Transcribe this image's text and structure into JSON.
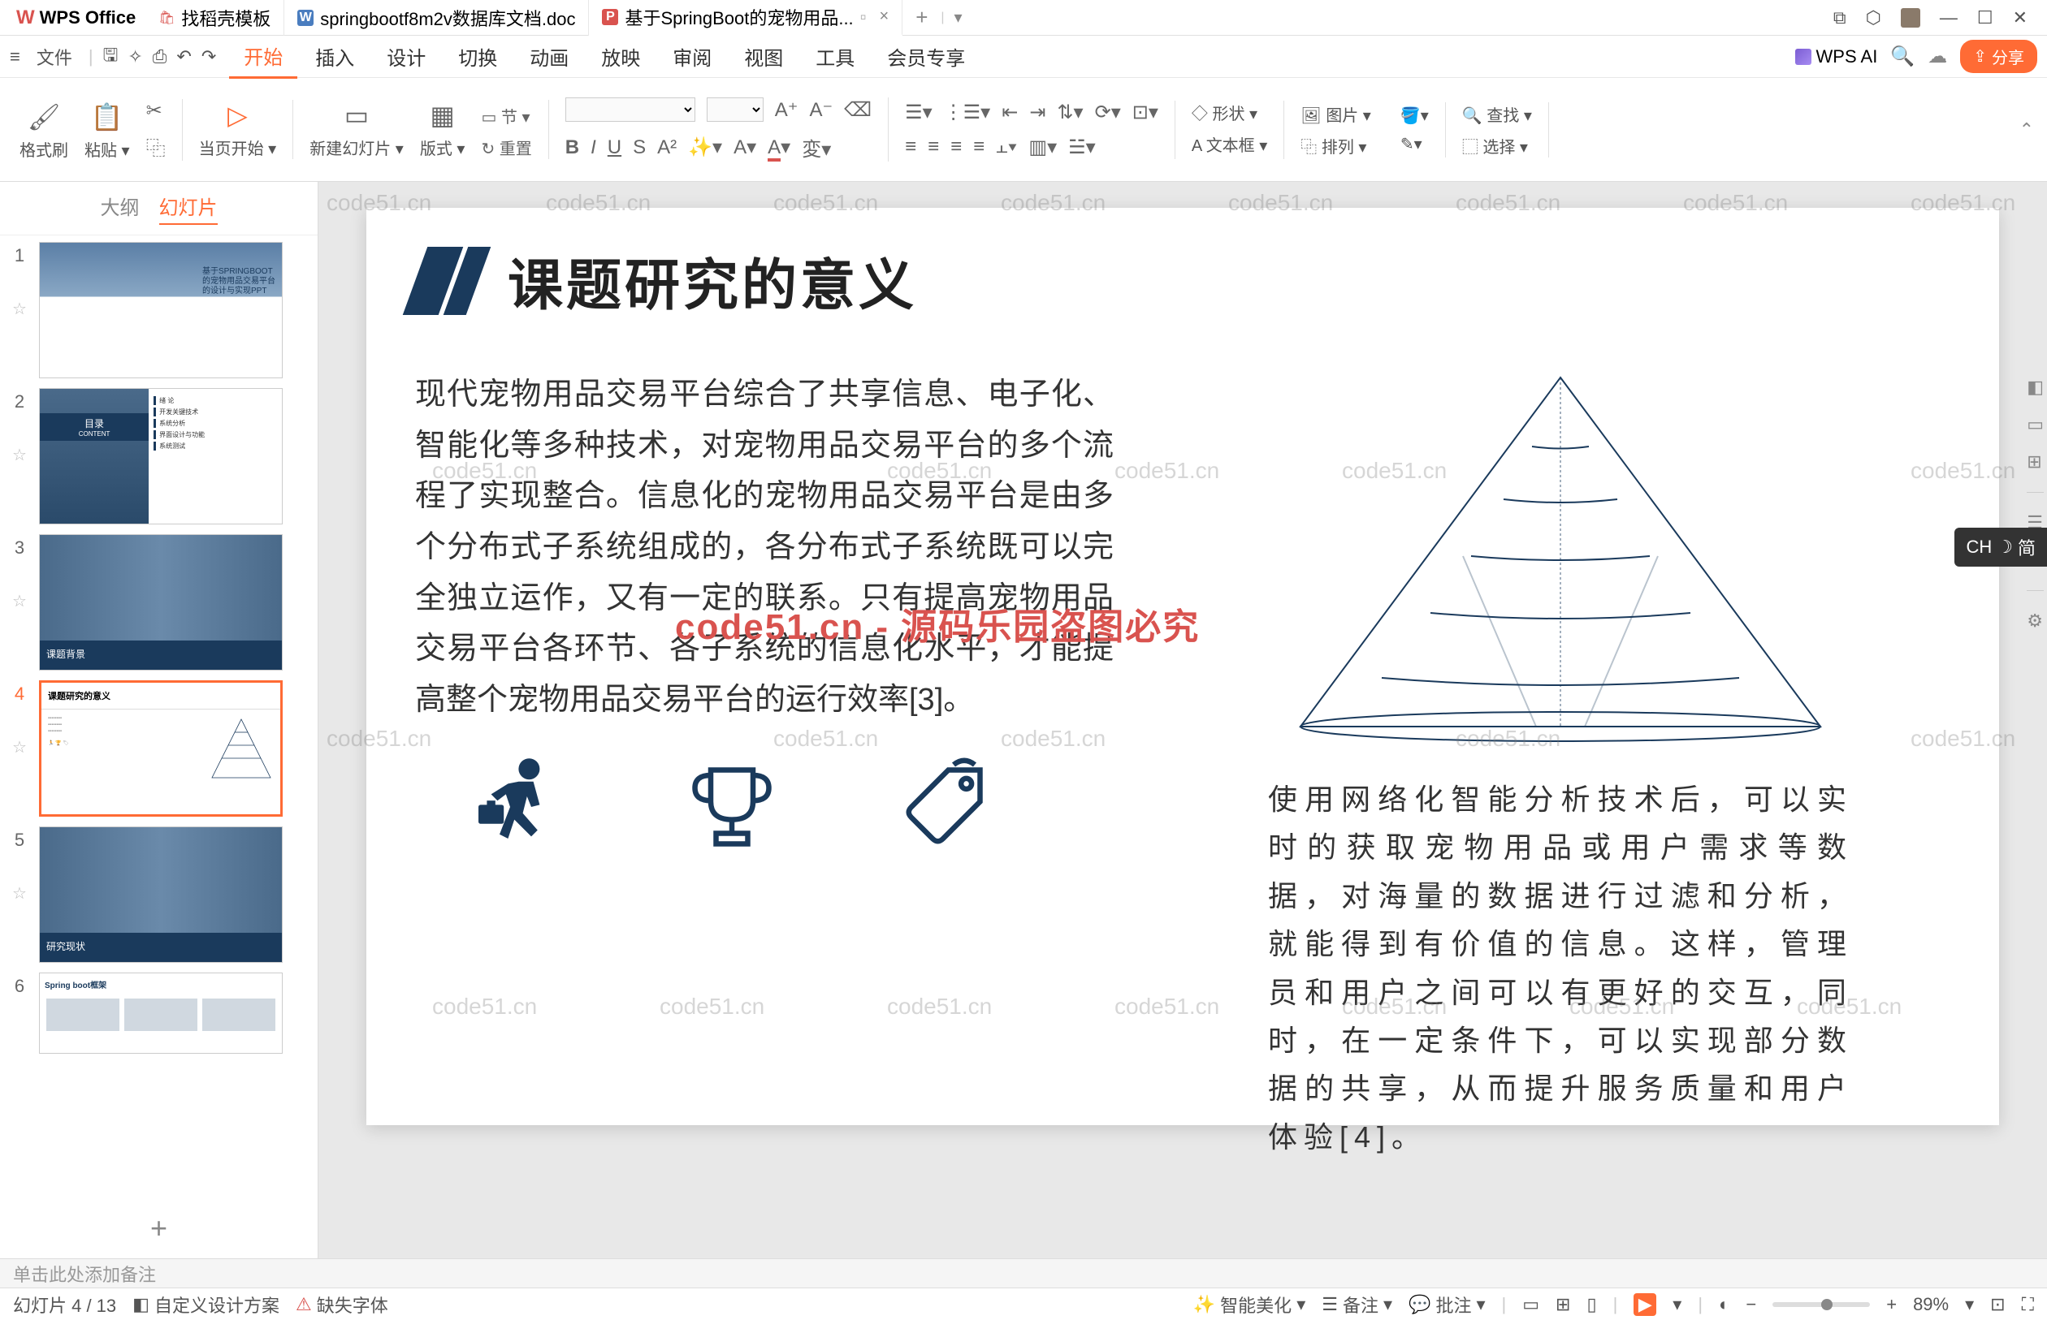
{
  "titlebar": {
    "app_name": "WPS Office",
    "tabs": [
      {
        "icon": "🛍",
        "label": "找稻壳模板",
        "color": "#d9534f"
      },
      {
        "icon": "W",
        "label": "springbootf8m2v数据库文档.doc",
        "color": "#4a7dbf"
      },
      {
        "icon": "P",
        "label": "基于SpringBoot的宠物用品...",
        "color": "#d9534f",
        "active": true
      }
    ]
  },
  "menubar": {
    "file": "文件",
    "items": [
      "开始",
      "插入",
      "设计",
      "切换",
      "动画",
      "放映",
      "审阅",
      "视图",
      "工具",
      "会员专享"
    ],
    "active_index": 0,
    "wps_ai": "WPS AI",
    "share": "分享"
  },
  "ribbon": {
    "format_painter": "格式刷",
    "paste": "粘贴",
    "current_page": "当页开始",
    "new_slide": "新建幻灯片",
    "layout": "版式",
    "section": "节",
    "reset": "重置",
    "shape": "形状",
    "picture": "图片",
    "textbox": "文本框",
    "arrange": "排列",
    "find": "查找",
    "select": "选择"
  },
  "panel": {
    "tab_outline": "大纲",
    "tab_slides": "幻灯片",
    "slides": [
      {
        "num": "1",
        "title_lines": [
          "基于SPRINGBOOT",
          "的宠物用品交易平台",
          "的设计与实现PPT"
        ]
      },
      {
        "num": "2",
        "menu_label": "目录",
        "menu_sub": "CONTENT",
        "items": [
          "绪 论",
          "开发关键技术",
          "系统分析",
          "界面设计与功能",
          "系统测试"
        ]
      },
      {
        "num": "3",
        "bar_label": "课题背景"
      },
      {
        "num": "4",
        "title": "课题研究的意义"
      },
      {
        "num": "5",
        "bar_label": "研究现状"
      },
      {
        "num": "6",
        "title": "Spring boot框架"
      }
    ]
  },
  "slide": {
    "title": "课题研究的意义",
    "para1": "现代宠物用品交易平台综合了共享信息、电子化、智能化等多种技术，对宠物用品交易平台的多个流程了实现整合。信息化的宠物用品交易平台是由多个分布式子系统组成的，各分布式子系统既可以完全独立运作，又有一定的联系。只有提高宠物用品交易平台各环节、各子系统的信息化水平，才能提高整个宠物用品交易平台的运行效率[3]。",
    "para2": "使用网络化智能分析技术后，可以实时的获取宠物用品或用户需求等数据，对海量的数据进行过滤和分析，就能得到有价值的信息。这样，管理员和用户之间可以有更好的交互，同时，在一定条件下，可以实现部分数据的共享，从而提升服务质量和用户体验[4]。",
    "watermark_red": "code51.cn - 源码乐园盗图必究",
    "watermark_text": "code51.cn"
  },
  "notes": {
    "placeholder": "单击此处添加备注"
  },
  "ime": {
    "label": "CH",
    "mode": "简"
  },
  "statusbar": {
    "slide_info": "幻灯片 4 / 13",
    "design": "自定义设计方案",
    "missing_font": "缺失字体",
    "beautify": "智能美化",
    "notes": "备注",
    "comments": "批注",
    "zoom": "89%"
  }
}
